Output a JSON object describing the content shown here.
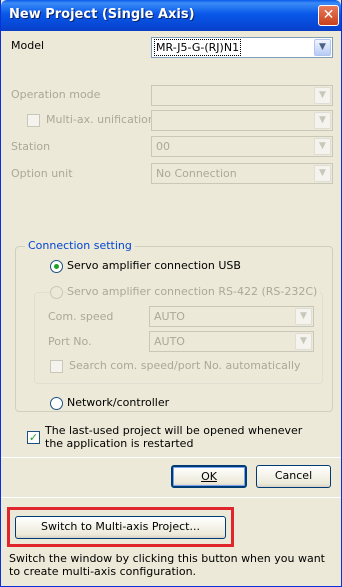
{
  "window": {
    "title": "New Project (Single Axis)",
    "close_label": "✕"
  },
  "model": {
    "label": "Model",
    "value": "MR-J5-G-(RJ)N1"
  },
  "operation_mode": {
    "label": "Operation mode",
    "value": ""
  },
  "multi_axis": {
    "label": "Multi-ax. unification",
    "value": ""
  },
  "station": {
    "label": "Station",
    "value": "00"
  },
  "option_unit": {
    "label": "Option unit",
    "value": "No Connection"
  },
  "connection": {
    "legend": "Connection setting",
    "usb_label": "Servo amplifier connection USB",
    "rs422_label": "Servo amplifier connection RS-422 (RS-232C)",
    "com_speed_label": "Com. speed",
    "com_speed_value": "AUTO",
    "port_label": "Port No.",
    "port_value": "AUTO",
    "search_label": "Search com. speed/port No. automatically",
    "network_label": "Network/controller"
  },
  "last_used": {
    "line1": "The last-used project will be opened whenever",
    "line2": "the application is restarted",
    "checked": true
  },
  "buttons": {
    "ok": "OK",
    "cancel": "Cancel",
    "switch": "Switch to Multi-axis Project..."
  },
  "description": {
    "line1": "Switch the window by clicking this button when you want",
    "line2": "to create multi-axis configuration."
  },
  "colors": {
    "highlight": "#e0262c",
    "titlebar": "#0958e9"
  }
}
